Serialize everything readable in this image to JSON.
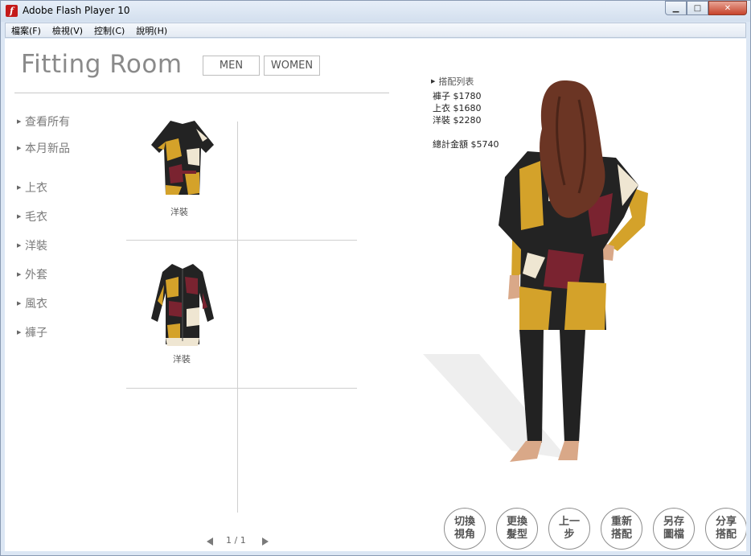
{
  "window": {
    "title": "Adobe Flash Player 10",
    "minimize": "▁",
    "maximize": "□",
    "close": "✕"
  },
  "menu": [
    "檔案(F)",
    "檢視(V)",
    "控制(C)",
    "說明(H)"
  ],
  "header": {
    "title": "Fitting Room",
    "men": "MEN",
    "women": "WOMEN"
  },
  "categories": [
    "查看所有",
    "本月新品",
    "上衣",
    "毛衣",
    "洋裝",
    "外套",
    "風衣",
    "褲子"
  ],
  "products": [
    {
      "caption": "洋裝",
      "icon": "dress-short-sleeve-icon"
    },
    {
      "caption": "洋裝",
      "icon": "dress-shirt-long-sleeve-icon"
    }
  ],
  "pager": {
    "text": "1 / 1"
  },
  "outfit": {
    "heading": "搭配列表",
    "items": [
      "褲子 $1780",
      "上衣 $1680",
      "洋裝 $2280"
    ],
    "total": "總計金額 $5740"
  },
  "actions": [
    "切換 視角",
    "更換 髮型",
    "上一步",
    "重新 搭配",
    "另存 圖檔",
    "分享 搭配"
  ],
  "colors": {
    "print_yellow": "#d4a22a",
    "print_red": "#7a2330",
    "print_black": "#232323",
    "print_cream": "#efe6d2",
    "hair": "#6b3524",
    "skin": "#d9a888"
  }
}
